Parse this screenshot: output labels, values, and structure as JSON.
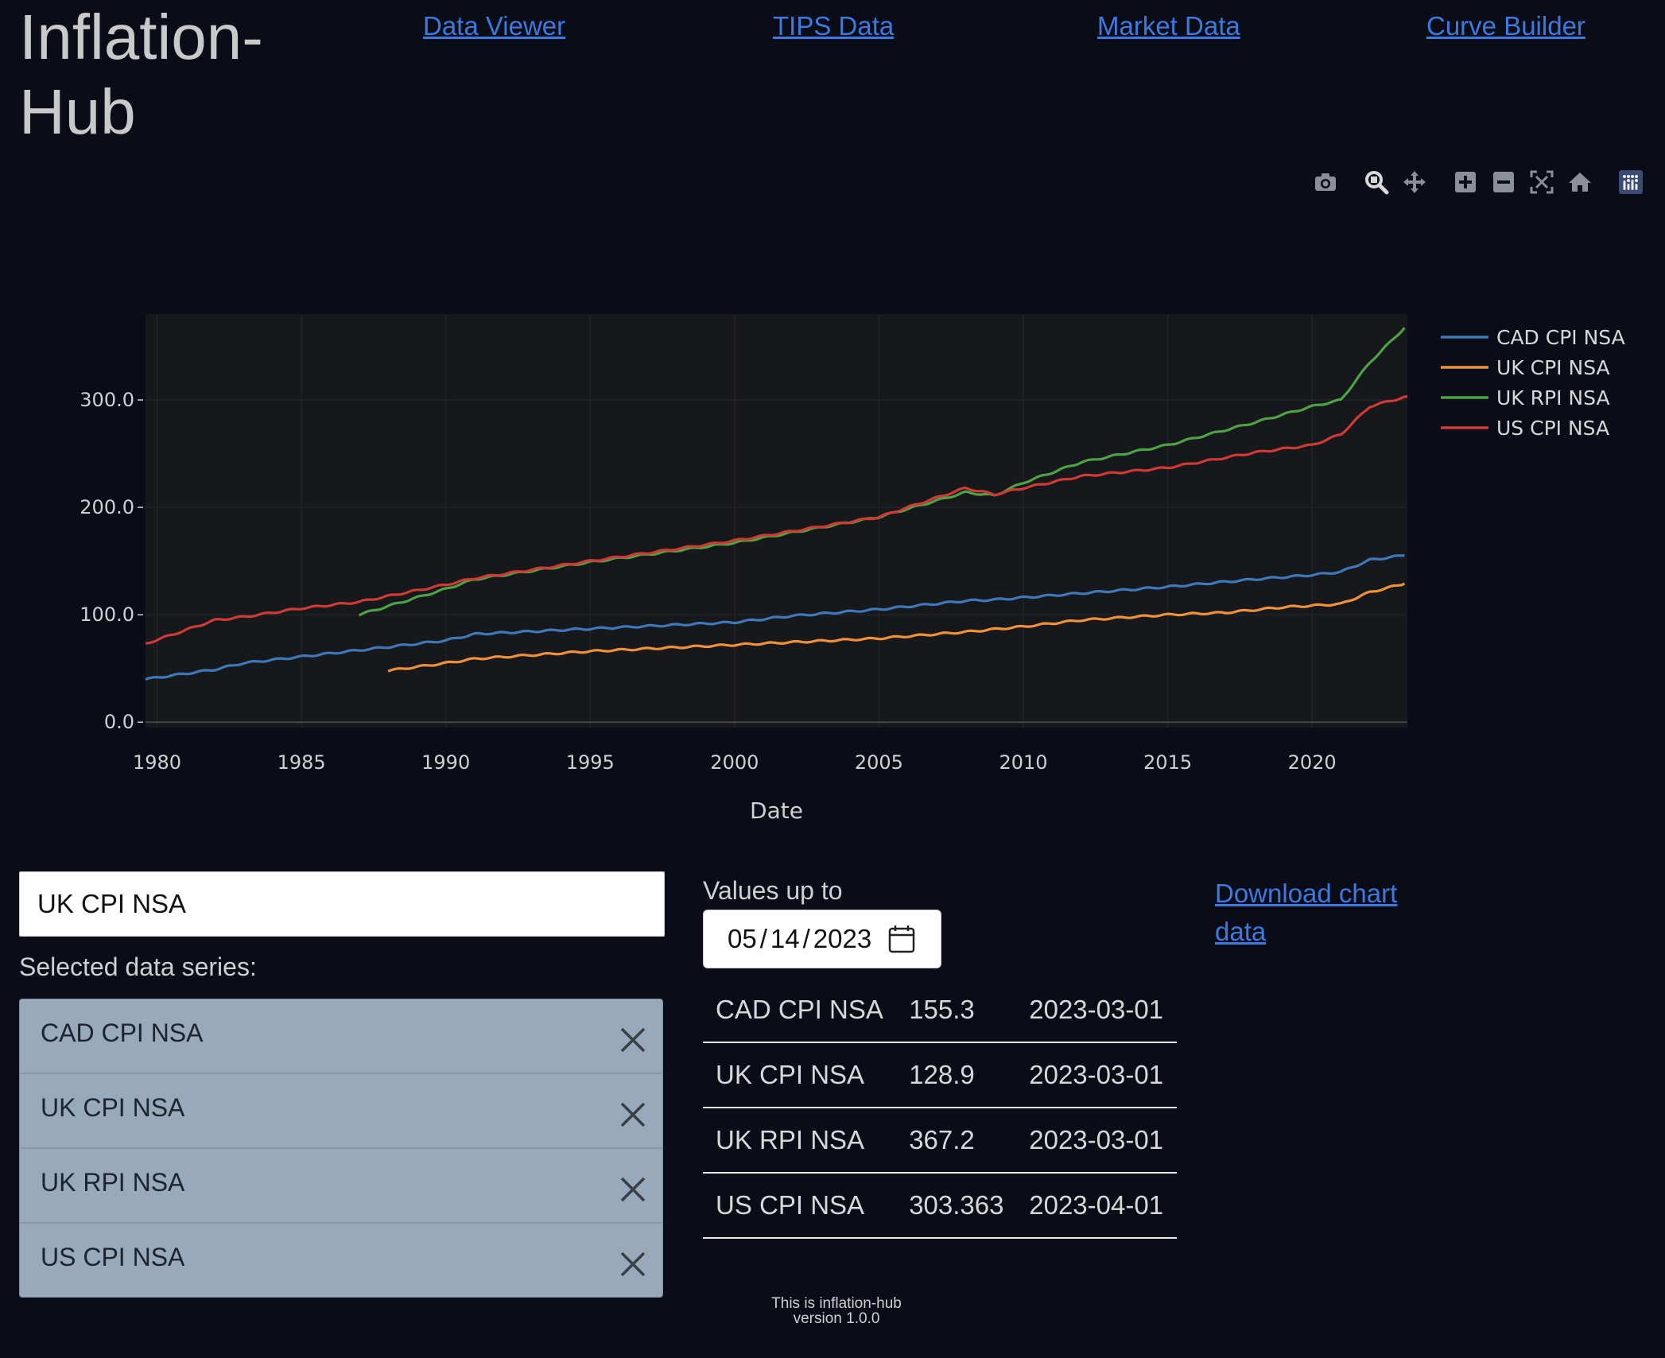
{
  "header": {
    "brand": "Inflation-Hub",
    "nav": [
      {
        "label": "Data Viewer"
      },
      {
        "label": "TIPS Data"
      },
      {
        "label": "Market Data"
      },
      {
        "label": "Curve Builder"
      }
    ]
  },
  "modebar": {
    "buttons": [
      "camera-icon",
      "zoom-icon",
      "pan-icon",
      "zoom-in-icon",
      "zoom-out-icon",
      "autoscale-icon",
      "reset-axes-icon",
      "plotly-logo-icon"
    ]
  },
  "chart_data": {
    "type": "line",
    "xlabel": "Date",
    "ylabel": "",
    "xlim": [
      1979.6,
      2023.3
    ],
    "ylim": [
      -5,
      380
    ],
    "x_ticks": [
      "1980",
      "1985",
      "1990",
      "1995",
      "2000",
      "2005",
      "2010",
      "2015",
      "2020"
    ],
    "y_ticks": [
      "0.0",
      "100.0",
      "200.0",
      "300.0"
    ],
    "legend_position": "right",
    "background": "#17181c",
    "series": [
      {
        "name": "CAD CPI NSA",
        "color": "#3f78b8",
        "points": [
          [
            1979.6,
            40
          ],
          [
            1982,
            49
          ],
          [
            1983,
            55
          ],
          [
            1985,
            61
          ],
          [
            1990,
            76
          ],
          [
            1991,
            82
          ],
          [
            1995,
            87
          ],
          [
            2000,
            93
          ],
          [
            2002,
            99
          ],
          [
            2005,
            105
          ],
          [
            2008,
            113
          ],
          [
            2009,
            114
          ],
          [
            2010,
            116
          ],
          [
            2015,
            126
          ],
          [
            2018,
            133
          ],
          [
            2020,
            137
          ],
          [
            2021,
            140
          ],
          [
            2022,
            151
          ],
          [
            2023.2,
            155.3
          ]
        ]
      },
      {
        "name": "UK CPI NSA",
        "color": "#f0913a",
        "points": [
          [
            1988,
            48
          ],
          [
            1990,
            55
          ],
          [
            1991,
            59
          ],
          [
            1995,
            66
          ],
          [
            2000,
            72
          ],
          [
            2005,
            78
          ],
          [
            2008,
            84
          ],
          [
            2010,
            89
          ],
          [
            2012,
            95
          ],
          [
            2015,
            100
          ],
          [
            2017,
            102
          ],
          [
            2019,
            107
          ],
          [
            2021,
            110
          ],
          [
            2022,
            121
          ],
          [
            2023.2,
            128.9
          ]
        ]
      },
      {
        "name": "UK RPI NSA",
        "color": "#4ea246",
        "points": [
          [
            1987,
            100
          ],
          [
            1990,
            124
          ],
          [
            1991,
            133
          ],
          [
            1995,
            149
          ],
          [
            2000,
            167
          ],
          [
            2005,
            191
          ],
          [
            2008,
            214
          ],
          [
            2009,
            211
          ],
          [
            2010,
            223
          ],
          [
            2012,
            242
          ],
          [
            2015,
            258
          ],
          [
            2018,
            279
          ],
          [
            2020,
            294
          ],
          [
            2021,
            300
          ],
          [
            2022,
            335
          ],
          [
            2023.2,
            367.2
          ]
        ]
      },
      {
        "name": "US CPI NSA",
        "color": "#cf3b34",
        "points": [
          [
            1979.6,
            73
          ],
          [
            1982,
            95
          ],
          [
            1983,
            98
          ],
          [
            1985,
            106
          ],
          [
            1987,
            112
          ],
          [
            1990,
            128
          ],
          [
            1991,
            134
          ],
          [
            1995,
            150
          ],
          [
            2000,
            169
          ],
          [
            2005,
            191
          ],
          [
            2008,
            218
          ],
          [
            2009,
            212
          ],
          [
            2010,
            218
          ],
          [
            2012,
            229
          ],
          [
            2015,
            237
          ],
          [
            2018,
            251
          ],
          [
            2020,
            258
          ],
          [
            2021,
            268
          ],
          [
            2022,
            294
          ],
          [
            2023.3,
            303.363
          ]
        ]
      }
    ]
  },
  "controls": {
    "search_value": "UK CPI NSA",
    "selected_label": "Selected data series:",
    "selected_series": [
      "CAD CPI NSA",
      "UK CPI NSA",
      "UK RPI NSA",
      "US CPI NSA"
    ],
    "values_label": "Values up to",
    "date": {
      "mm": "05",
      "dd": "14",
      "yyyy": "2023"
    },
    "table": [
      [
        "CAD CPI NSA",
        "155.3",
        "2023-03-01"
      ],
      [
        "UK CPI NSA",
        "128.9",
        "2023-03-01"
      ],
      [
        "UK RPI NSA",
        "367.2",
        "2023-03-01"
      ],
      [
        "US CPI NSA",
        "303.363",
        "2023-04-01"
      ]
    ],
    "download_label": "Download chart data"
  },
  "footer": {
    "line1": "This is inflation-hub",
    "line2": "version 1.0.0"
  }
}
